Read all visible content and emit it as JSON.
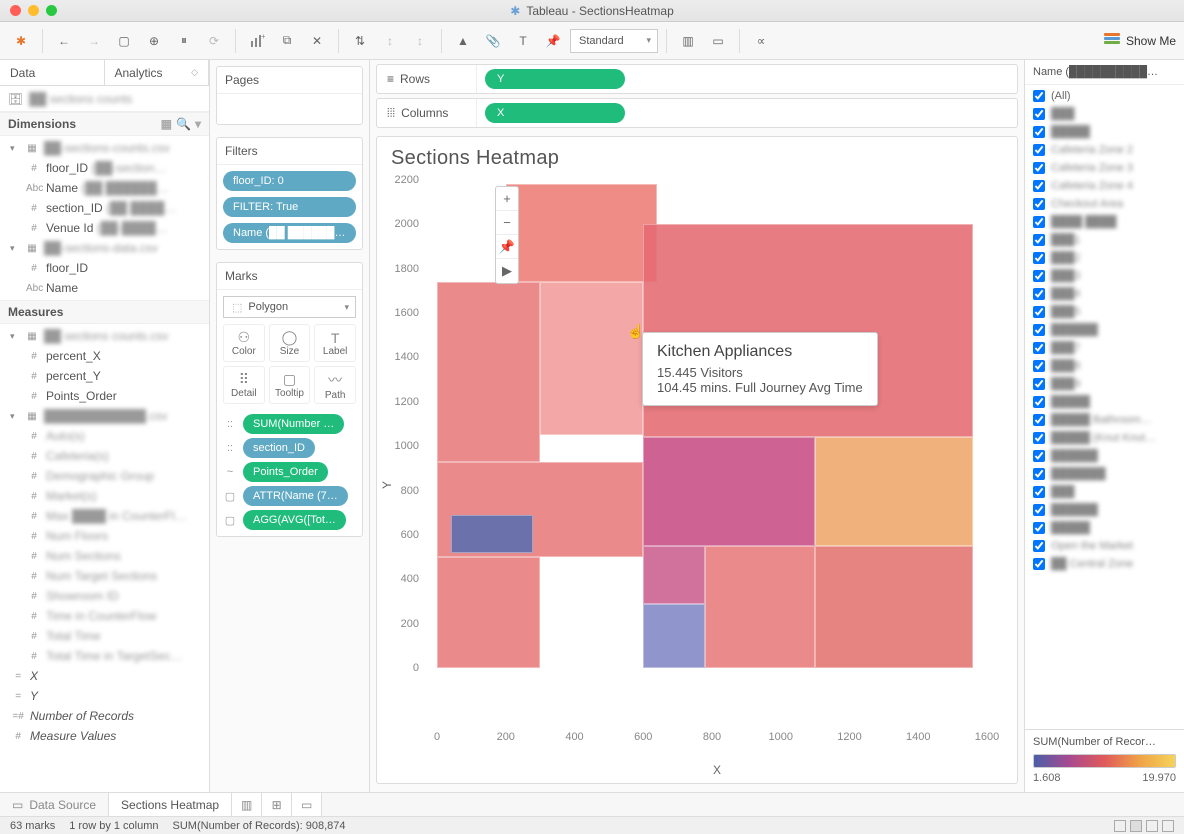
{
  "window": {
    "title": "Tableau - SectionsHeatmap"
  },
  "toolbar": {
    "format_mode": "Standard",
    "showme": "Show Me"
  },
  "side_tabs": {
    "data": "Data",
    "analytics": "Analytics"
  },
  "data_source_name": "██ sections counts",
  "dimensions_header": "Dimensions",
  "measures_header": "Measures",
  "dimensions_tree": {
    "group1_name": "██-sections-counts.csv",
    "group1": [
      {
        "icon": "#",
        "label": "floor_ID",
        "extra": "(██-section…"
      },
      {
        "icon": "Abc",
        "label": "Name",
        "extra": "(██ ██████…"
      },
      {
        "icon": "#",
        "label": "section_ID",
        "extra": "(██ ████…"
      },
      {
        "icon": "#",
        "label": "Venue Id",
        "extra": "(██-████…"
      }
    ],
    "group2_name": "██-sections-data.csv",
    "group2": [
      {
        "icon": "#",
        "label": "floor_ID"
      },
      {
        "icon": "Abc",
        "label": "Name"
      }
    ]
  },
  "measures_tree": {
    "group1_name": "██ sections counts.csv",
    "group1": [
      {
        "icon": "#",
        "label": "percent_X"
      },
      {
        "icon": "#",
        "label": "percent_Y"
      },
      {
        "icon": "#",
        "label": "Points_Order"
      }
    ],
    "group2_name": "████████████.csv",
    "group2_items": [
      "Auto(s)",
      "Cafeteria(s)",
      "Demographic Group",
      "Market(s)",
      "Max ████ in CounterFl…",
      "Num Floors",
      "Num Sections",
      "Num Target Sections",
      "Showroom ID",
      "Time in CounterFlow",
      "Total Time",
      "Total Time in TargetSec…"
    ],
    "bottom": [
      {
        "icon": "=",
        "label": "X",
        "italic": true
      },
      {
        "icon": "=",
        "label": "Y",
        "italic": true
      },
      {
        "icon": "=#",
        "label": "Number of Records",
        "italic": true
      },
      {
        "icon": "#",
        "label": "Measure Values",
        "italic": true
      }
    ]
  },
  "pages_header": "Pages",
  "filters_header": "Filters",
  "filters": [
    "floor_ID: 0",
    "FILTER: True",
    "Name (██ ██████…"
  ],
  "marks_header": "Marks",
  "marks_type": "Polygon",
  "marks_cells": [
    "Color",
    "Size",
    "Label",
    "Detail",
    "Tooltip",
    "Path"
  ],
  "marks_pills": [
    {
      "lead": "::",
      "label": "SUM(Number …",
      "cls": "green"
    },
    {
      "lead": "::",
      "label": "section_ID",
      "cls": "blue"
    },
    {
      "lead": "~",
      "label": "Points_Order",
      "cls": "green"
    },
    {
      "lead": "▢",
      "label": "ATTR(Name (7…",
      "cls": "blue"
    },
    {
      "lead": "▢",
      "label": "AGG(AVG([Tot…",
      "cls": "green"
    }
  ],
  "shelves": {
    "rows_label": "Rows",
    "rows_pill": "Y",
    "cols_label": "Columns",
    "cols_pill": "X"
  },
  "viz": {
    "title": "Sections Heatmap",
    "x_label": "X",
    "y_label": "Y",
    "x_ticks": [
      "0",
      "200",
      "400",
      "600",
      "800",
      "1000",
      "1200",
      "1400",
      "1600"
    ],
    "y_ticks": [
      "0",
      "200",
      "400",
      "600",
      "800",
      "1000",
      "1200",
      "1400",
      "1600",
      "1800",
      "2000",
      "2200"
    ]
  },
  "chart_data": {
    "type": "heatmap",
    "title": "Sections Heatmap",
    "xlabel": "X",
    "ylabel": "Y",
    "xlim": [
      0,
      1600
    ],
    "ylim": [
      0,
      2200
    ],
    "color_field": "SUM(Number of Records)",
    "color_range": [
      1.608,
      19.97
    ],
    "sections": [
      {
        "x0": 0,
        "x1": 300,
        "y0": 0,
        "y1": 500,
        "color": "#e87a7a"
      },
      {
        "x0": 0,
        "x1": 600,
        "y0": 500,
        "y1": 930,
        "color": "#e87a7a"
      },
      {
        "x0": 40,
        "x1": 280,
        "y0": 520,
        "y1": 690,
        "color": "#5a6fb0"
      },
      {
        "x0": 300,
        "x1": 600,
        "y0": 1050,
        "y1": 1740,
        "color": "#f29c9c"
      },
      {
        "x0": 0,
        "x1": 300,
        "y0": 930,
        "y1": 1740,
        "color": "#e87a7a"
      },
      {
        "x0": 200,
        "x1": 640,
        "y0": 1740,
        "y1": 2180,
        "color": "#ef7d76"
      },
      {
        "x0": 600,
        "x1": 780,
        "y0": 0,
        "y1": 290,
        "color": "#8187c4"
      },
      {
        "x0": 600,
        "x1": 780,
        "y0": 290,
        "y1": 550,
        "color": "#ca5f8f"
      },
      {
        "x0": 600,
        "x1": 1100,
        "y0": 550,
        "y1": 1040,
        "color": "#c84d84"
      },
      {
        "x0": 600,
        "x1": 1560,
        "y0": 1040,
        "y1": 2000,
        "color": "#e56b72"
      },
      {
        "x0": 780,
        "x1": 1100,
        "y0": 0,
        "y1": 550,
        "color": "#e87a7a"
      },
      {
        "x0": 1100,
        "x1": 1560,
        "y0": 0,
        "y1": 550,
        "color": "#e2746f"
      },
      {
        "x0": 1100,
        "x1": 1560,
        "y0": 550,
        "y1": 1040,
        "color": "#f0a76a"
      }
    ],
    "tooltip": {
      "name": "Kitchen Appliances",
      "line1": "15.445 Visitors",
      "line2": "104.45 mins. Full Journey Avg Time"
    }
  },
  "right": {
    "header": "Name (██████████…",
    "all": "(All)",
    "items": [
      "███",
      "█████",
      "Cafeteria Zone 2",
      "Cafeteria Zone 3",
      "Cafeteria Zone 4",
      "Checkout Area",
      "████ ████",
      "███1",
      "███2",
      "███3",
      "███4",
      "███5",
      "██████",
      "███7",
      "███8",
      "███9",
      "█████",
      "█████ Bathroom…",
      "█████ (Knut Knut…",
      "██████",
      "███████",
      "███",
      "██████",
      "█████",
      "Open the Market",
      "██ Central Zone"
    ]
  },
  "legend": {
    "title": "SUM(Number of Recor…",
    "min": "1.608",
    "max": "19.970"
  },
  "sheet_tabs": {
    "ds": "Data Source",
    "sheet": "Sections Heatmap"
  },
  "status": {
    "marks": "63 marks",
    "rc": "1 row by 1 column",
    "sum": "SUM(Number of Records): 908,874"
  }
}
